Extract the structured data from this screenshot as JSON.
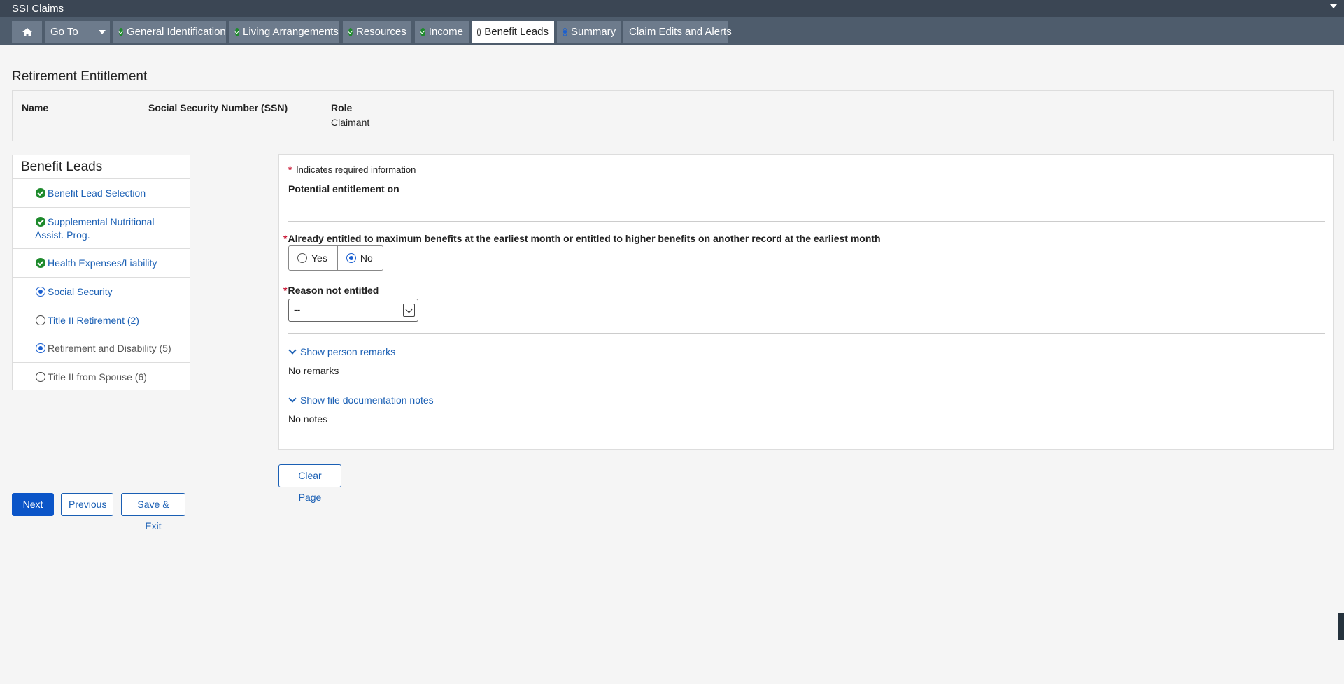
{
  "app": {
    "title": "SSI Claims"
  },
  "nav": {
    "home_label": "",
    "goto_label": "Go To",
    "tabs": [
      {
        "label": "General Identification",
        "status": "complete"
      },
      {
        "label": "Living Arrangements",
        "status": "complete"
      },
      {
        "label": "Resources",
        "status": "complete"
      },
      {
        "label": "Income",
        "status": "complete"
      },
      {
        "label": "Benefit Leads",
        "status": "not-started",
        "active": true
      },
      {
        "label": "Summary",
        "status": "in-progress"
      },
      {
        "label": "Claim Edits and Alerts",
        "status": "none"
      }
    ]
  },
  "page": {
    "title": "Retirement Entitlement"
  },
  "person": {
    "name_header": "Name",
    "ssn_header": "Social Security Number (SSN)",
    "role_header": "Role",
    "role_value": "Claimant"
  },
  "sidebar": {
    "title": "Benefit Leads",
    "items": [
      {
        "label": "Benefit Lead Selection",
        "status": "complete"
      },
      {
        "label": "Supplemental Nutritional Assist. Prog.",
        "status": "complete"
      },
      {
        "label": "Health Expenses/Liability",
        "status": "complete"
      },
      {
        "label": "Social Security",
        "status": "in-progress"
      },
      {
        "label": "Title II Retirement (2)",
        "status": "not-started"
      },
      {
        "label": "Retirement and Disability (5)",
        "status": "in-progress"
      },
      {
        "label": "Title II from Spouse (6)",
        "status": "not-started"
      }
    ]
  },
  "form": {
    "required_star": "*",
    "required_note": "Indicates required information",
    "section_heading": "Potential entitlement on",
    "q1_label": "Already entitled to maximum benefits at the earliest month or entitled to higher benefits on another record at the earliest month",
    "q1_yes": "Yes",
    "q1_no": "No",
    "q1_selected": "No",
    "q2_label": "Reason not entitled",
    "q2_value": "--",
    "remarks_link": "Show person remarks",
    "remarks_value": "No remarks",
    "notes_link": "Show file documentation notes",
    "notes_value": "No notes"
  },
  "buttons": {
    "clear": "Clear Page",
    "next": "Next",
    "previous": "Previous",
    "save_exit": "Save & Exit"
  },
  "colors": {
    "navbar": "#4e5c6c",
    "tab": "#6d7b8c",
    "link": "#1a5fb4",
    "complete": "#1e8a2c",
    "primary": "#0b55c8",
    "required": "#c8102e"
  }
}
